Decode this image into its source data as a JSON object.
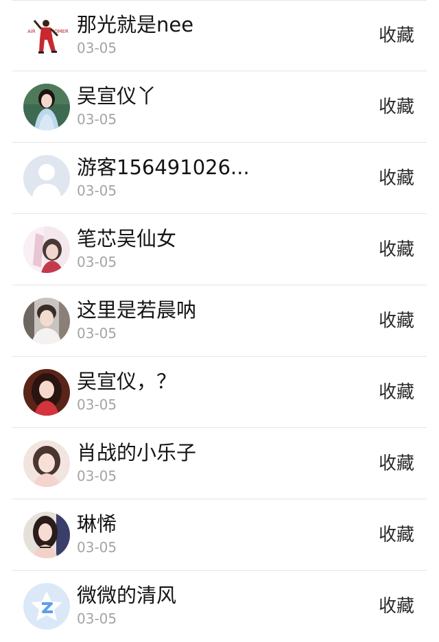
{
  "comments": [
    {
      "name": "那光就是nee",
      "date": "03-05",
      "action": "收藏",
      "avatar": "basketball-player-avatar"
    },
    {
      "name": "吴宣仪丫",
      "date": "03-05",
      "action": "收藏",
      "avatar": "girl-blue-dress-avatar"
    },
    {
      "name": "游客156491026...",
      "date": "03-05",
      "action": "收藏",
      "avatar": "default-guest-avatar"
    },
    {
      "name": "笔芯吴仙女",
      "date": "03-05",
      "action": "收藏",
      "avatar": "girl-pink-avatar"
    },
    {
      "name": "这里是若晨呐",
      "date": "03-05",
      "action": "收藏",
      "avatar": "boy-avatar"
    },
    {
      "name": "吴宣仪，？",
      "date": "03-05",
      "action": "收藏",
      "avatar": "girl-red-avatar"
    },
    {
      "name": "肖战的小乐子",
      "date": "03-05",
      "action": "收藏",
      "avatar": "girl-portrait-avatar"
    },
    {
      "name": "琳悕",
      "date": "03-05",
      "action": "收藏",
      "avatar": "girl-dark-hair-avatar"
    },
    {
      "name": "微微的清风",
      "date": "03-05",
      "action": "收藏",
      "avatar": "qzone-default-avatar"
    }
  ],
  "colors": {
    "name": "#141414",
    "date": "#a4a4a4",
    "action": "#2a2a2a",
    "divider": "#e4e4e4"
  }
}
